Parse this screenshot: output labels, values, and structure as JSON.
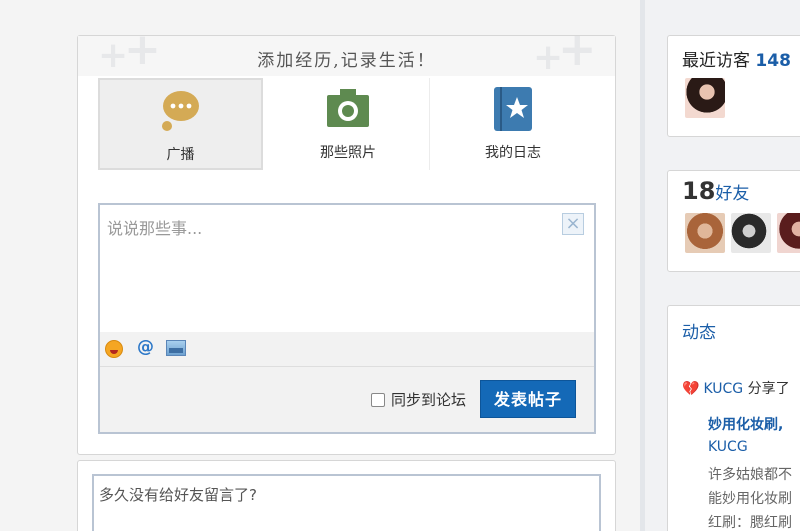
{
  "composer": {
    "banner_title": "添加经历,记录生活！",
    "tabs": [
      {
        "label": "广播",
        "icon": "speech-bubble-icon",
        "active": true
      },
      {
        "label": "那些照片",
        "icon": "camera-icon",
        "active": false
      },
      {
        "label": "我的日志",
        "icon": "journal-star-icon",
        "active": false
      }
    ],
    "placeholder": "说说那些事...",
    "toolbar": {
      "emoji_icon": "emoji-icon",
      "at_label": "@",
      "image_icon": "image-icon"
    },
    "sync_label": "同步到论坛",
    "post_button": "发表帖子"
  },
  "message": {
    "placeholder": "多久没有给好友留言了?"
  },
  "visitors": {
    "label": "最近访客",
    "count": "148"
  },
  "friends": {
    "count": "18",
    "label": "好友"
  },
  "activity": {
    "title": "动态",
    "user": "KUCG",
    "action": "分享了",
    "post_title": "妙用化妆刷,",
    "post_author": "KUCG",
    "lines": [
      "许多姑娘都不",
      "能妙用化妆刷",
      "红刷：腮红刷"
    ]
  },
  "colors": {
    "accent_blue": "#1469b7",
    "link_blue": "#1b5ea8",
    "editor_border": "#b9c4d3"
  }
}
